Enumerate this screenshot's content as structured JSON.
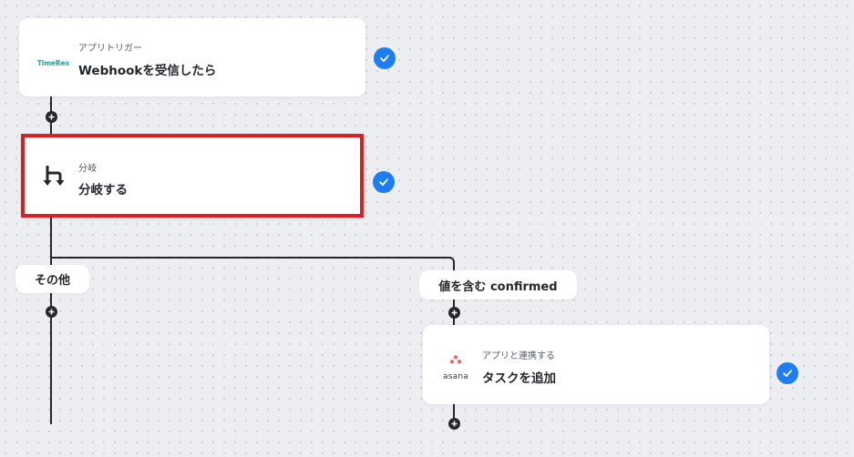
{
  "flow": {
    "trigger": {
      "app_logo_text": "TimeRex",
      "subtitle": "アプリトリガー",
      "title": "Webhookを受信したら"
    },
    "branch": {
      "subtitle": "分岐",
      "title": "分岐する",
      "highlight_color": "#d9201f"
    },
    "branches": {
      "left_label": "その他",
      "right_label": "値を含む confirmed"
    },
    "action": {
      "app_logo_text": "asana",
      "subtitle": "アプリと連携する",
      "title": "タスクを追加"
    },
    "colors": {
      "accent": "#1e7df0",
      "line": "#24272d",
      "background": "#eceef2",
      "asana_dots": "#f06a6a",
      "timerex": "#18a5a5"
    }
  }
}
